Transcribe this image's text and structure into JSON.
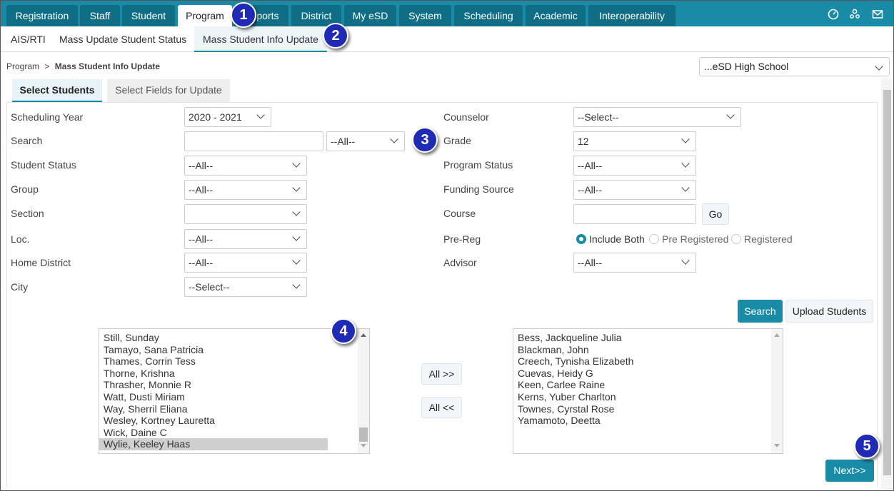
{
  "top_nav": {
    "tabs": [
      {
        "label": "Registration"
      },
      {
        "label": "Staff"
      },
      {
        "label": "Student"
      },
      {
        "label": "Program"
      },
      {
        "label": "Reports"
      },
      {
        "label": "District"
      },
      {
        "label": "My eSD"
      },
      {
        "label": "System"
      },
      {
        "label": "Scheduling"
      },
      {
        "label": "Academic"
      },
      {
        "label": "Interoperability"
      }
    ],
    "active": "Program",
    "icons": [
      "dashboard-icon",
      "users-icon",
      "mail-icon"
    ]
  },
  "sub_nav": {
    "items": [
      {
        "label": "AIS/RTI"
      },
      {
        "label": "Mass Update Student Status"
      },
      {
        "label": "Mass Student Info Update"
      }
    ],
    "active": "Mass Student Info Update"
  },
  "breadcrumb": {
    "root": "Program",
    "separator": ">",
    "current": "Mass Student Info Update"
  },
  "school": {
    "selected": "...eSD High School"
  },
  "inner_tabs": {
    "select_students": "Select Students",
    "select_fields": "Select Fields for Update"
  },
  "filters": {
    "scheduling_year": {
      "label": "Scheduling Year",
      "value": "2020 - 2021"
    },
    "search": {
      "label": "Search",
      "value": "",
      "scope": "--All--"
    },
    "student_status": {
      "label": "Student Status",
      "value": "--All--"
    },
    "group": {
      "label": "Group",
      "value": "--All--"
    },
    "section": {
      "label": "Section",
      "value": ""
    },
    "loc": {
      "label": "Loc.",
      "value": "--All--"
    },
    "home_district": {
      "label": "Home District",
      "value": "--All--"
    },
    "city": {
      "label": "City",
      "value": "--Select--"
    },
    "counselor": {
      "label": "Counselor",
      "value": "--Select--"
    },
    "grade": {
      "label": "Grade",
      "value": "12"
    },
    "program_status": {
      "label": "Program Status",
      "value": "--All--"
    },
    "funding_source": {
      "label": "Funding Source",
      "value": "--All--"
    },
    "course": {
      "label": "Course",
      "value": "",
      "go_label": "Go"
    },
    "pre_reg": {
      "label": "Pre-Reg",
      "options": [
        "Include Both",
        "Pre Registered",
        "Registered"
      ],
      "selected": "Include Both"
    },
    "advisor": {
      "label": "Advisor",
      "value": "--All--"
    }
  },
  "actions": {
    "search": "Search",
    "upload": "Upload Students",
    "all_right": "All >>",
    "all_left": "All <<",
    "next": "Next>>"
  },
  "available_students": [
    "Still, Sunday",
    "Tamayo, Sana Patricia",
    "Thames, Corrin Tess",
    "Thorne, Krishna",
    "Thrasher, Monnie R",
    "Watt, Dusti Miriam",
    "Way, Sherril Eliana",
    "Wesley, Kortney Lauretta",
    "Wick, Daine C",
    "Wylie, Keeley Haas"
  ],
  "available_selected": "Wylie, Keeley Haas",
  "selected_students": [
    "Bess, Jackqueline Julia",
    "Blackman, John",
    "Creech, Tynisha Elizabeth",
    "Cuevas, Heidy G",
    "Keen, Carlee Raine",
    "Kerns, Yuber Charlton",
    "Townes, Cyrstal Rose",
    "Yamamoto, Deetta"
  ],
  "callouts": [
    "1",
    "2",
    "3",
    "4",
    "5"
  ],
  "colors": {
    "accent": "#1a8ba6",
    "accent_dark": "#0f6e85",
    "callout": "#1f2bb4"
  }
}
